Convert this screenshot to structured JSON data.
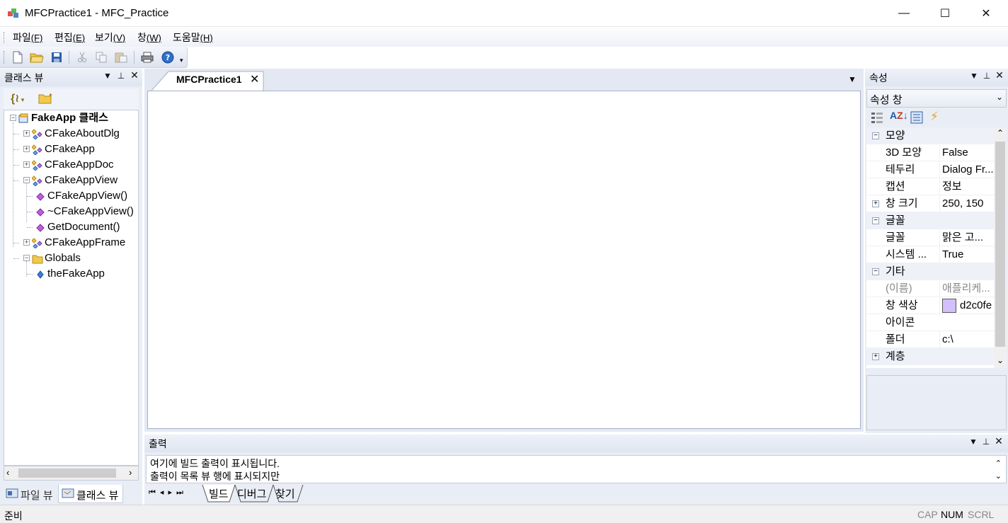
{
  "window": {
    "title": "MFCPractice1 - MFC_Practice",
    "minimize": "—",
    "maximize": "☐",
    "close": "✕"
  },
  "menu": {
    "items": [
      {
        "label": "파일",
        "key": "(F)"
      },
      {
        "label": "편집",
        "key": "(E)"
      },
      {
        "label": "보기",
        "key": "(V)"
      },
      {
        "label": "창",
        "key": "(W)"
      },
      {
        "label": "도움말",
        "key": "(H)"
      }
    ]
  },
  "toolbar": {
    "buttons": [
      "new-file-icon",
      "open-folder-icon",
      "save-icon",
      "cut-icon",
      "copy-icon",
      "paste-icon",
      "print-icon",
      "help-icon"
    ]
  },
  "class_view": {
    "title": "클래스 뷰",
    "tree": [
      {
        "label": "FakeApp 클래스",
        "level": 0,
        "expander": "−",
        "icon": "project-icon",
        "bold": true
      },
      {
        "label": "CFakeAboutDlg",
        "level": 1,
        "expander": "+",
        "icon": "class-icon"
      },
      {
        "label": "CFakeApp",
        "level": 1,
        "expander": "+",
        "icon": "class-icon"
      },
      {
        "label": "CFakeAppDoc",
        "level": 1,
        "expander": "+",
        "icon": "class-icon"
      },
      {
        "label": "CFakeAppView",
        "level": 1,
        "expander": "−",
        "icon": "class-icon"
      },
      {
        "label": "CFakeAppView()",
        "level": 2,
        "expander": "",
        "icon": "method-icon"
      },
      {
        "label": "~CFakeAppView()",
        "level": 2,
        "expander": "",
        "icon": "method-icon"
      },
      {
        "label": "GetDocument()",
        "level": 2,
        "expander": "",
        "icon": "method-icon"
      },
      {
        "label": "CFakeAppFrame",
        "level": 1,
        "expander": "+",
        "icon": "class-icon"
      },
      {
        "label": "Globals",
        "level": 1,
        "expander": "−",
        "icon": "folder-icon"
      },
      {
        "label": "theFakeApp",
        "level": 2,
        "expander": "",
        "icon": "variable-icon"
      }
    ],
    "tabs": [
      {
        "label": "파일 뷰",
        "icon": "file-view-icon"
      },
      {
        "label": "클래스 뷰",
        "icon": "class-view-icon"
      }
    ]
  },
  "document": {
    "tab_label": "MFCPractice1"
  },
  "properties": {
    "title": "속성",
    "combo_value": "속성 창",
    "rows": [
      {
        "type": "cat",
        "name": "모양",
        "exp": "−"
      },
      {
        "type": "prop",
        "name": "3D 모양",
        "value": "False"
      },
      {
        "type": "prop",
        "name": "테두리",
        "value": "Dialog Fr..."
      },
      {
        "type": "prop",
        "name": "캡션",
        "value": "정보"
      },
      {
        "type": "prop",
        "name": "창 크기",
        "value": "250, 150",
        "exp": "+"
      },
      {
        "type": "cat",
        "name": "글꼴",
        "exp": "−"
      },
      {
        "type": "prop",
        "name": "글꼴",
        "value": "맑은 고..."
      },
      {
        "type": "prop",
        "name": "시스템 ...",
        "value": "True"
      },
      {
        "type": "cat",
        "name": "기타",
        "exp": "−"
      },
      {
        "type": "prop",
        "name": "(이름)",
        "value": "애플리케...",
        "disabled": true
      },
      {
        "type": "prop",
        "name": "창 색상",
        "value": "d2c0fe",
        "swatch": "#d2c0fe"
      },
      {
        "type": "prop",
        "name": "아이콘",
        "value": ""
      },
      {
        "type": "prop",
        "name": "폴더",
        "value": "c:\\"
      },
      {
        "type": "cat",
        "name": "계층",
        "exp": "+"
      }
    ]
  },
  "output": {
    "title": "출력",
    "lines": [
      "여기에 빌드 출력이 표시됩니다.",
      "출력이 목록 뷰 행에 표시되지만"
    ],
    "tabs": [
      "빌드",
      "디버그",
      "찾기"
    ]
  },
  "status": {
    "text": "준비",
    "indicators": [
      {
        "label": "CAP",
        "active": false
      },
      {
        "label": "NUM",
        "active": true
      },
      {
        "label": "SCRL",
        "active": false
      }
    ]
  },
  "colors": {
    "panel_bg": "#e9edf5",
    "header_grad_top": "#eef1f8",
    "accent_blue": "#1e5aa8"
  }
}
